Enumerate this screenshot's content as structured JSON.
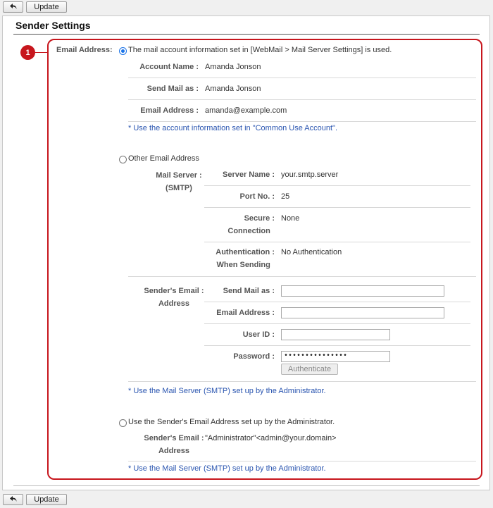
{
  "toolbar": {
    "update_label": "Update"
  },
  "page": {
    "title": "Sender Settings",
    "marker": "1"
  },
  "email_address_label": "Email Address",
  "option_webmail": {
    "text": "The mail account information set in [WebMail > Mail Server Settings] is used.",
    "selected": true,
    "rows": [
      {
        "label": "Account Name",
        "value": "Amanda Jonson"
      },
      {
        "label": "Send Mail as",
        "value": "Amanda Jonson"
      },
      {
        "label": "Email Address",
        "value": "amanda@example.com"
      }
    ],
    "note": "* Use the account information set in \"Common Use Account\"."
  },
  "option_other": {
    "text": "Other Email Address",
    "selected": false,
    "mail_server_label_1": "Mail Server",
    "mail_server_label_2": "(SMTP)",
    "server_rows": {
      "server_name_label": "Server Name",
      "server_name_value": "your.smtp.server",
      "port_label": "Port No.",
      "port_value": "25",
      "secure_label_1": "Secure",
      "secure_label_2": "Connection",
      "secure_value": "None",
      "auth_label_1": "Authentication",
      "auth_label_2": "When Sending",
      "auth_value": "No Authentication"
    },
    "sender_label_1": "Sender's Email",
    "sender_label_2": "Address",
    "fields": {
      "send_mail_as_label": "Send Mail as",
      "send_mail_as_value": "",
      "email_label": "Email Address",
      "email_value": "",
      "user_id_label": "User ID",
      "user_id_value": "",
      "password_label": "Password",
      "password_value": "•••••••••••••••"
    },
    "authenticate_label": "Authenticate",
    "note": "* Use the Mail Server (SMTP) set up by the Administrator."
  },
  "option_admin": {
    "text": "Use the Sender's Email Address set up by the Administrator.",
    "selected": false,
    "sender_label_1": "Sender's Email",
    "sender_label_2": "Address",
    "sender_value": "\"Administrator\"<admin@your.domain>",
    "note": "* Use the Mail Server (SMTP) set up by the Administrator."
  }
}
